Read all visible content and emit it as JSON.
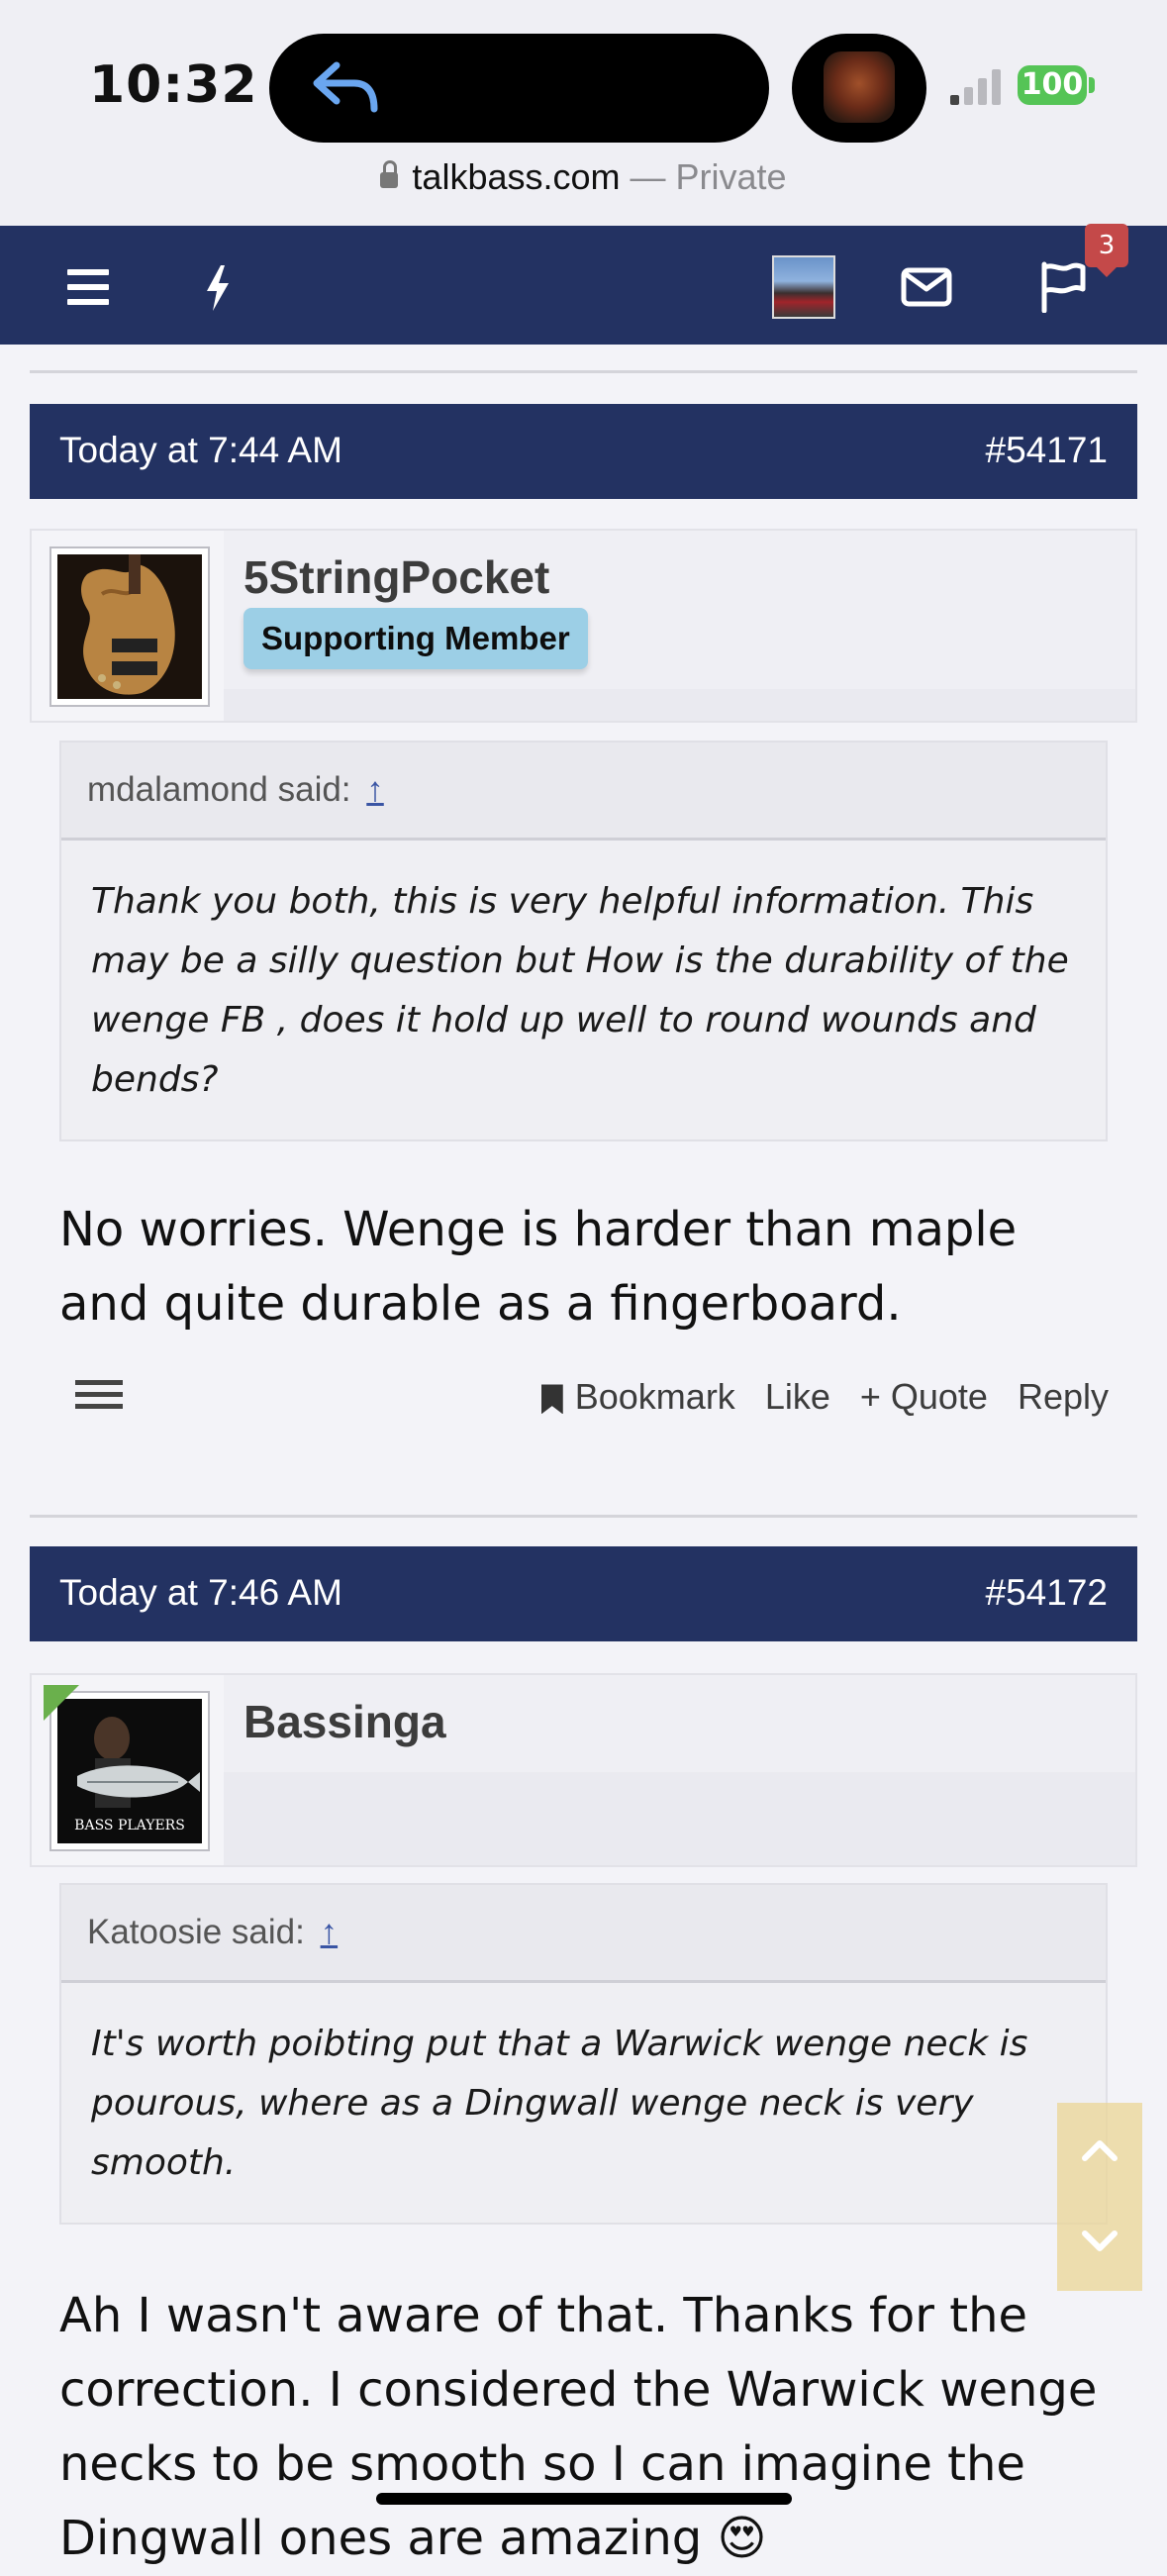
{
  "status_bar": {
    "time": "10:32",
    "battery": "100",
    "battery_color": "#55c456",
    "island_icon": "reply-arrow-icon"
  },
  "browser": {
    "domain": "talkbass.com",
    "private_label": "— Private"
  },
  "nav": {
    "background": "#233262",
    "notification_count": "3",
    "icons": [
      "menu-icon",
      "bolt-icon",
      "avatar",
      "mail-icon",
      "flag-icon"
    ]
  },
  "posts": [
    {
      "date": "Today at 7:44 AM",
      "number": "#54171",
      "username": "5StringPocket",
      "role": "Supporting Member",
      "quote_author": "mdalamond said:",
      "quote_link": "↑",
      "quote_text": "Thank you both, this is very helpful information. This may be a silly question but How is the durability of the wenge FB , does it hold up well to round wounds and bends?",
      "message": "No worries. Wenge is harder than maple and quite durable as a fingerboard.",
      "actions": {
        "bookmark": "Bookmark",
        "like": "Like",
        "quote": "+ Quote",
        "reply": "Reply"
      }
    },
    {
      "date": "Today at 7:46 AM",
      "number": "#54172",
      "username": "Bassinga",
      "avatar_caption": "BASS PLAYERS",
      "quote_author": "Katoosie said:",
      "quote_link": "↑",
      "quote_text": "It's worth poibting put that a Warwick wenge neck is pourous, where as a Dingwall wenge neck is very smooth.",
      "message": "Ah I wasn't aware of that. Thanks for the correction. I considered the Warwick wenge necks to be smooth so I can imagine the Dingwall ones are amazing 😍"
    }
  ]
}
